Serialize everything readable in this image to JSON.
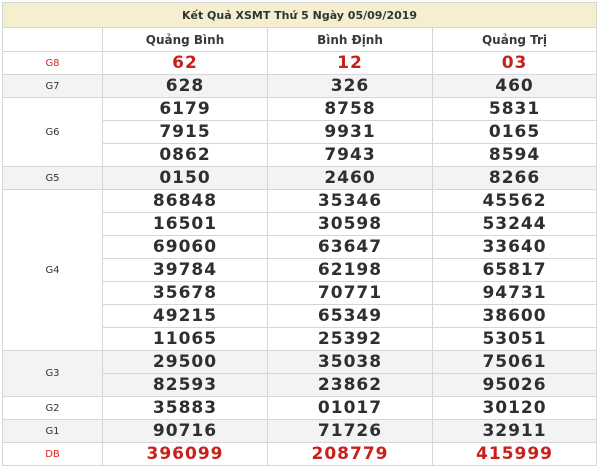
{
  "title": "Kết Quả XSMT Thứ 5 Ngày 05/09/2019",
  "provinces": [
    "Quảng Bình",
    "Bình Định",
    "Quảng Trị"
  ],
  "prizes": [
    {
      "label": "G8",
      "rows": [
        [
          "62",
          "12",
          "03"
        ]
      ]
    },
    {
      "label": "G7",
      "rows": [
        [
          "628",
          "326",
          "460"
        ]
      ]
    },
    {
      "label": "G6",
      "rows": [
        [
          "6179",
          "8758",
          "5831"
        ],
        [
          "7915",
          "9931",
          "0165"
        ],
        [
          "0862",
          "7943",
          "8594"
        ]
      ]
    },
    {
      "label": "G5",
      "rows": [
        [
          "0150",
          "2460",
          "8266"
        ]
      ]
    },
    {
      "label": "G4",
      "rows": [
        [
          "86848",
          "35346",
          "45562"
        ],
        [
          "16501",
          "30598",
          "53244"
        ],
        [
          "69060",
          "63647",
          "33640"
        ],
        [
          "39784",
          "62198",
          "65817"
        ],
        [
          "35678",
          "70771",
          "94731"
        ],
        [
          "49215",
          "65349",
          "38600"
        ],
        [
          "11065",
          "25392",
          "53051"
        ]
      ]
    },
    {
      "label": "G3",
      "rows": [
        [
          "29500",
          "35038",
          "75061"
        ],
        [
          "82593",
          "23862",
          "95026"
        ]
      ]
    },
    {
      "label": "G2",
      "rows": [
        [
          "35883",
          "01017",
          "30120"
        ]
      ]
    },
    {
      "label": "G1",
      "rows": [
        [
          "90716",
          "71726",
          "32911"
        ]
      ]
    },
    {
      "label": "DB",
      "rows": [
        [
          "396099",
          "208779",
          "415999"
        ]
      ]
    }
  ],
  "colors": {
    "header_bg": "#f4f0cf",
    "alt_row_bg": "#f3f3f3",
    "highlight_red": "#c8211d",
    "border": "#d6d6d6"
  }
}
